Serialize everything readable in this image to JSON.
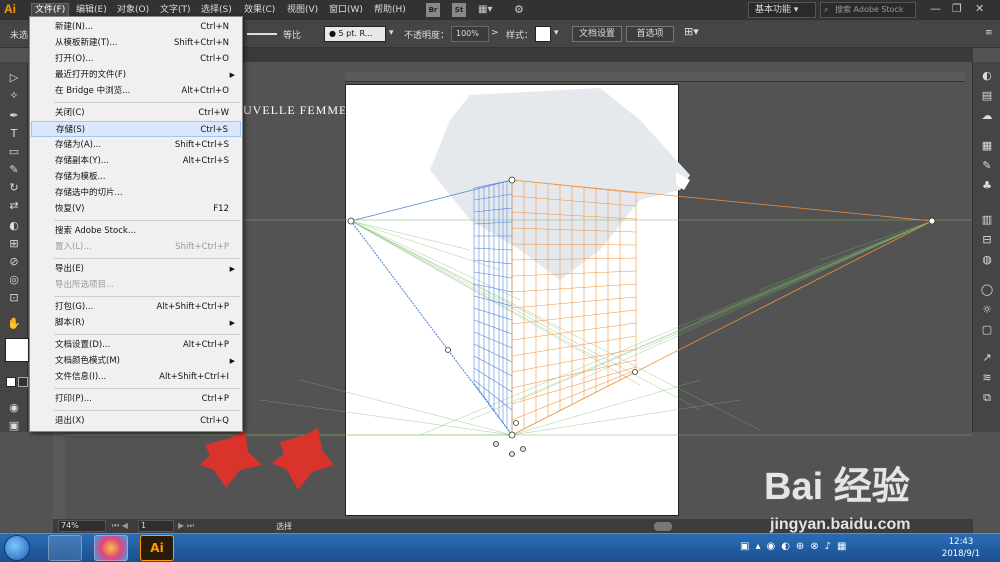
{
  "app": {
    "logo": "Ai"
  },
  "menubar": {
    "items": [
      "文件(F)",
      "编辑(E)",
      "对象(O)",
      "文字(T)",
      "选择(S)",
      "效果(C)",
      "视图(V)",
      "窗口(W)",
      "帮助(H)"
    ],
    "bridge": "Br",
    "stock": "St",
    "workspace": "基本功能",
    "search_placeholder": "搜索 Adobe Stock"
  },
  "controlbar": {
    "selection_prefix": "未选",
    "stroke_label": "等比",
    "brush_label": "● 5 pt. R...",
    "opacity_label": "不透明度：",
    "opacity_value": "100%",
    "style_label": "样式：",
    "doc_setup_button": "文档设置",
    "preferences_button": "首选项"
  },
  "canvas": {
    "text_overlay": "UVELLE FEMME"
  },
  "statusbar": {
    "zoom": "74%",
    "page": "1",
    "status": "选择"
  },
  "file_menu": {
    "items": [
      {
        "label": "新建(N)...",
        "shortcut": "Ctrl+N"
      },
      {
        "label": "从模板新建(T)...",
        "shortcut": "Shift+Ctrl+N"
      },
      {
        "label": "打开(O)...",
        "shortcut": "Ctrl+O"
      },
      {
        "label": "最近打开的文件(F)",
        "shortcut": ""
      },
      {
        "label": "在 Bridge 中浏览...",
        "shortcut": "Alt+Ctrl+O"
      },
      {
        "label": "关闭(C)",
        "shortcut": "Ctrl+W"
      },
      {
        "label": "存储(S)",
        "shortcut": "Ctrl+S"
      },
      {
        "label": "存储为(A)...",
        "shortcut": "Shift+Ctrl+S"
      },
      {
        "label": "存储副本(Y)...",
        "shortcut": "Alt+Ctrl+S"
      },
      {
        "label": "存储为模板...",
        "shortcut": ""
      },
      {
        "label": "存储选中的切片...",
        "shortcut": ""
      },
      {
        "label": "恢复(V)",
        "shortcut": "F12"
      },
      {
        "label": "搜索 Adobe Stock...",
        "shortcut": ""
      },
      {
        "label": "置入(L)...",
        "shortcut": "Shift+Ctrl+P"
      },
      {
        "label": "导出(E)",
        "shortcut": ""
      },
      {
        "label": "导出所选项目...",
        "shortcut": ""
      },
      {
        "label": "打包(G)...",
        "shortcut": "Alt+Shift+Ctrl+P"
      },
      {
        "label": "脚本(R)",
        "shortcut": ""
      },
      {
        "label": "文档设置(D)...",
        "shortcut": "Alt+Ctrl+P"
      },
      {
        "label": "文档颜色模式(M)",
        "shortcut": ""
      },
      {
        "label": "文件信息(I)...",
        "shortcut": "Alt+Shift+Ctrl+I"
      },
      {
        "label": "打印(P)...",
        "shortcut": "Ctrl+P"
      },
      {
        "label": "退出(X)",
        "shortcut": "Ctrl+Q"
      }
    ]
  },
  "taskbar": {
    "ai_label": "Ai",
    "time": "12:43",
    "date": "2018/9/1"
  },
  "watermark": {
    "brand": "Bai 经验",
    "url": "jingyan.baidu.com"
  },
  "colors": {
    "grid_left": "#4a7fd4",
    "grid_right": "#f0913a",
    "ground": "#7ab86a",
    "red_shapes": "#d9332b"
  }
}
